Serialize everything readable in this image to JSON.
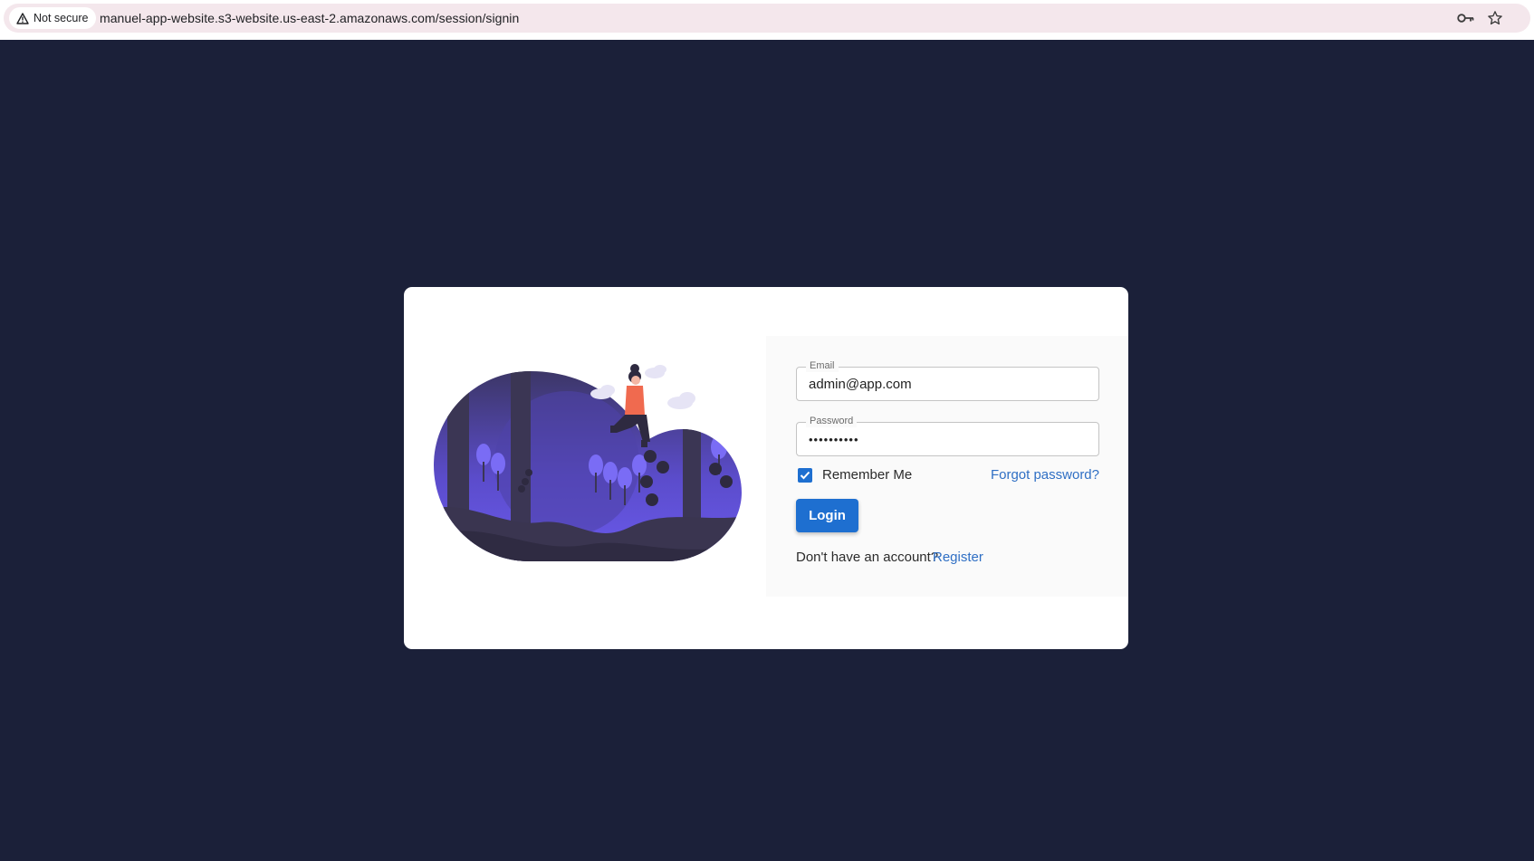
{
  "browser": {
    "security_label": "Not secure",
    "url": "manuel-app-website.s3-website.us-east-2.amazonaws.com/session/signin",
    "icons": [
      "warning-icon",
      "key-icon",
      "star-icon"
    ]
  },
  "colors": {
    "background": "#1b2039",
    "card": "#ffffff",
    "primary": "#1e6fd0",
    "link": "#2f6fc4"
  },
  "login": {
    "email_label": "Email",
    "email_value": "admin@app.com",
    "password_label": "Password",
    "password_value": "••••••••••",
    "remember_label": "Remember Me",
    "remember_checked": true,
    "forgot_label": "Forgot password?",
    "login_label": "Login",
    "no_account_text": "Don't have an account?",
    "register_label": "Register"
  }
}
